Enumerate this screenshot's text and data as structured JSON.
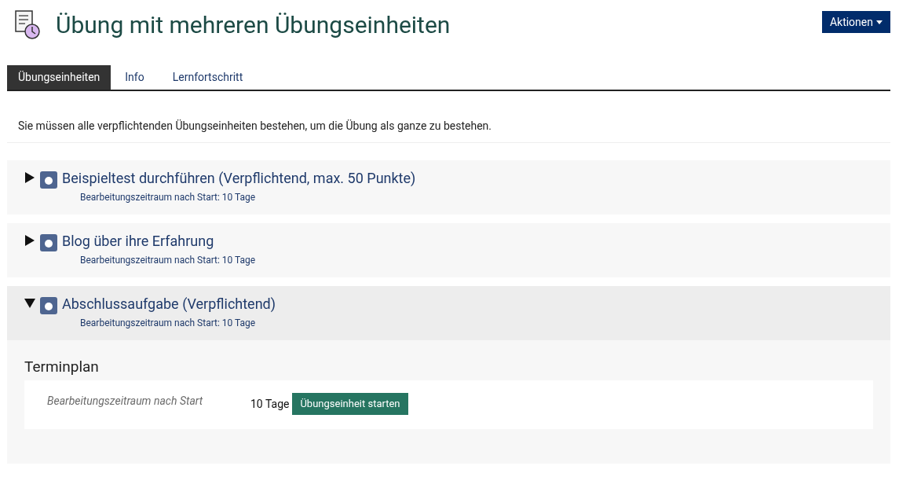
{
  "header": {
    "title": "Übung mit mehreren Übungseinheiten",
    "actions_button": "Aktionen"
  },
  "tabs": [
    {
      "label": "Übungseinheiten",
      "selected": true
    },
    {
      "label": "Info",
      "selected": false
    },
    {
      "label": "Lernfortschritt",
      "selected": false
    }
  ],
  "description": "Sie müssen alle verpflichtenden Übungseinheiten bestehen, um die Übung als ganze zu bestehen.",
  "units": [
    {
      "title": "Beispieltest durchführen (Verpflichtend, max. 50 Punkte)",
      "subtitle": "Bearbeitungszeitraum nach Start: 10 Tage",
      "expanded": false
    },
    {
      "title": "Blog über ihre Erfahrung",
      "subtitle": "Bearbeitungszeitraum nach Start: 10 Tage",
      "expanded": false
    },
    {
      "title": "Abschlussaufgabe (Verpflichtend)",
      "subtitle": "Bearbeitungszeitraum nach Start: 10 Tage",
      "expanded": true,
      "details": {
        "heading": "Terminplan",
        "label": "Bearbeitungszeitraum nach Start",
        "value": "10 Tage",
        "button": "Übungseinheit starten"
      }
    }
  ]
}
